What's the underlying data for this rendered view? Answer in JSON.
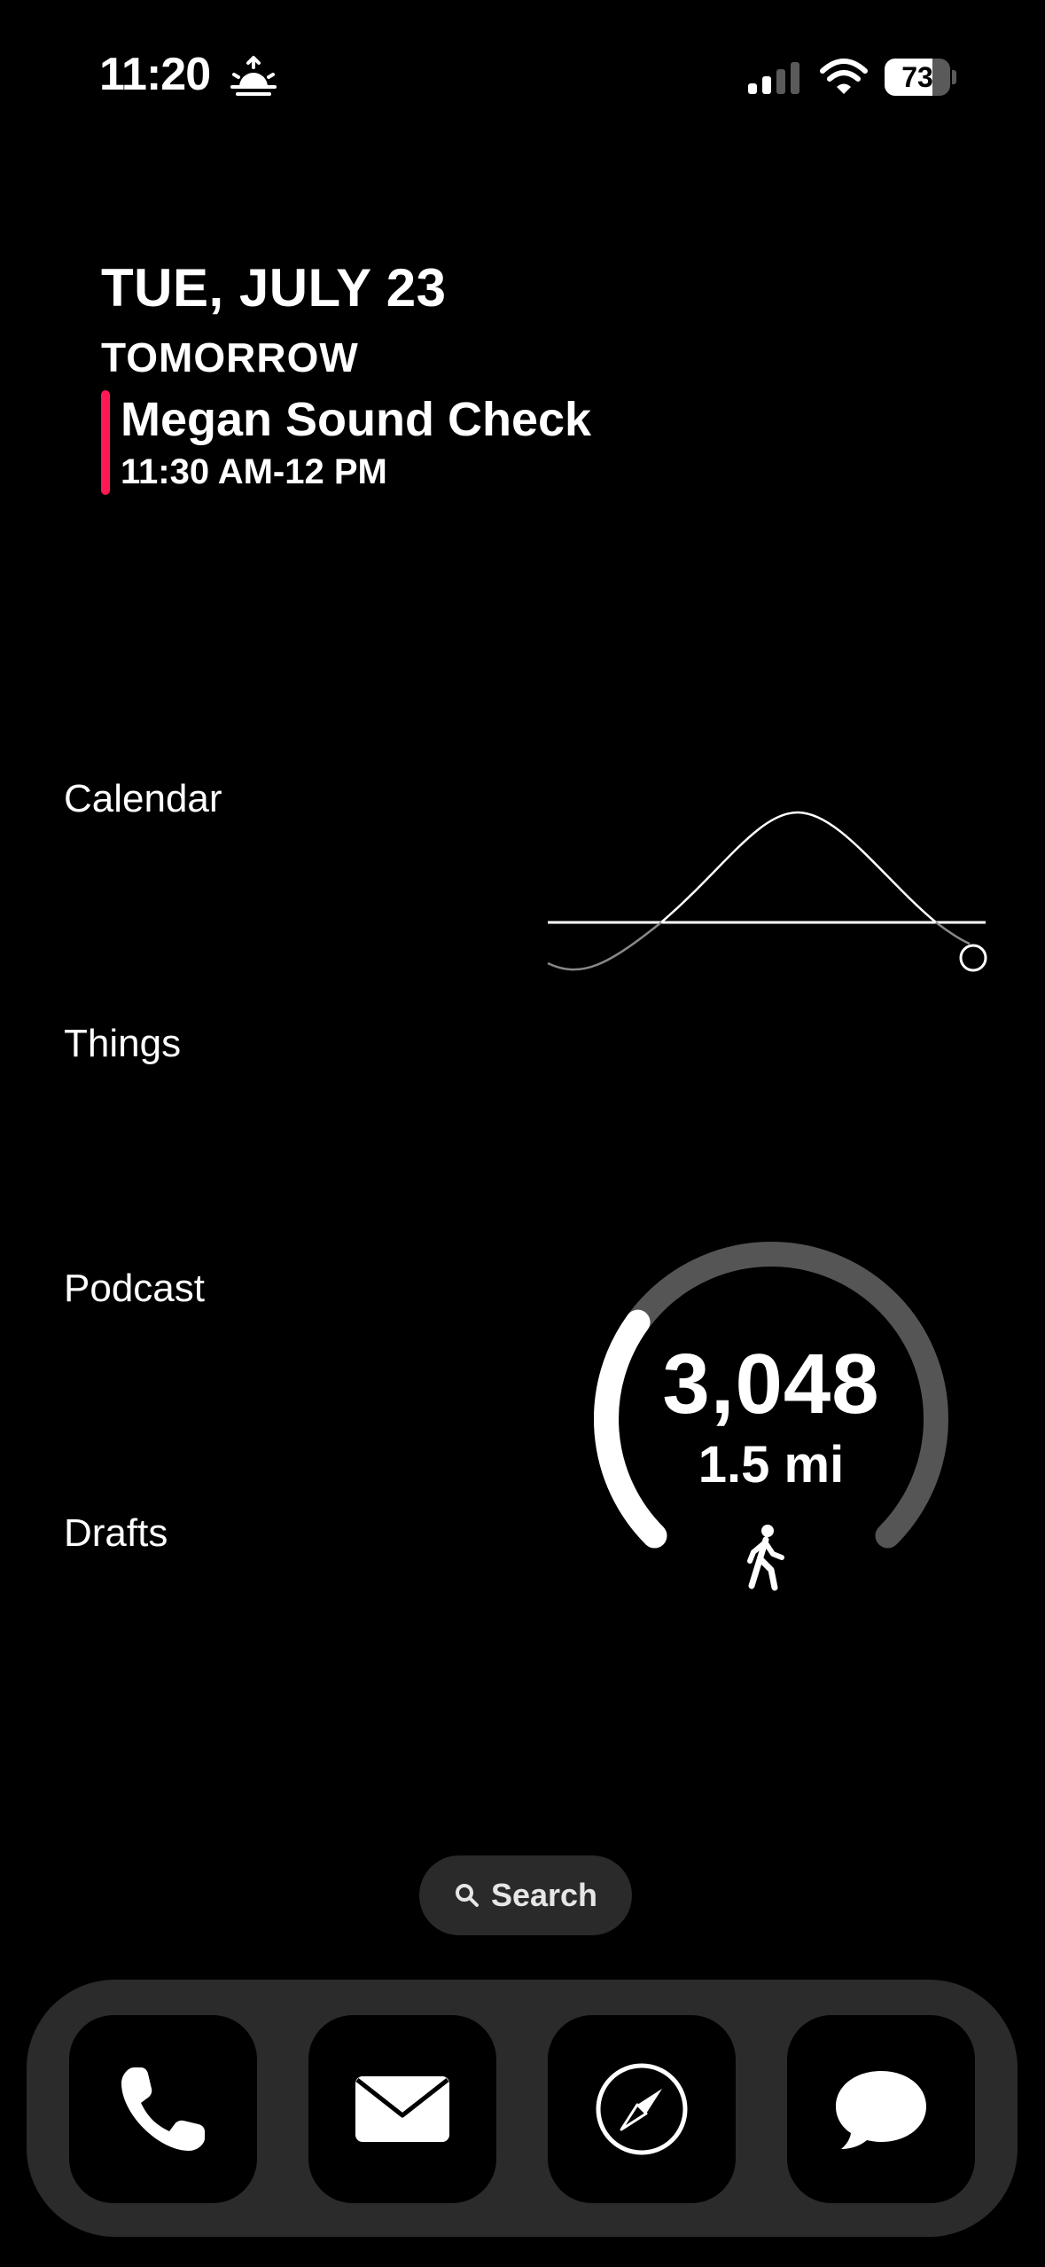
{
  "status_bar": {
    "time": "11:20",
    "battery_level": "73",
    "battery_fraction": 0.73,
    "icons": [
      "sunrise-icon",
      "cellular-signal-icon",
      "wifi-icon",
      "battery-icon"
    ]
  },
  "calendar_widget": {
    "date": "TUE, JULY 23",
    "day_label": "TOMORROW",
    "event_title": "Megan Sound Check",
    "event_time": "11:30 AM-12 PM",
    "event_color": "#ff1a55"
  },
  "shortcuts": [
    {
      "label": "Calendar"
    },
    {
      "label": "Things"
    },
    {
      "label": "Podcast"
    },
    {
      "label": "Drafts"
    }
  ],
  "steps_widget": {
    "steps": "3,048",
    "distance": "1.5 mi",
    "progress": 0.3,
    "icon": "walking-icon"
  },
  "search": {
    "label": "Search",
    "icon": "search-icon"
  },
  "dock": {
    "apps": [
      {
        "name": "Phone",
        "icon": "phone-icon"
      },
      {
        "name": "Mail",
        "icon": "mail-icon"
      },
      {
        "name": "Safari",
        "icon": "compass-icon"
      },
      {
        "name": "Messages",
        "icon": "message-bubble-icon"
      }
    ]
  }
}
